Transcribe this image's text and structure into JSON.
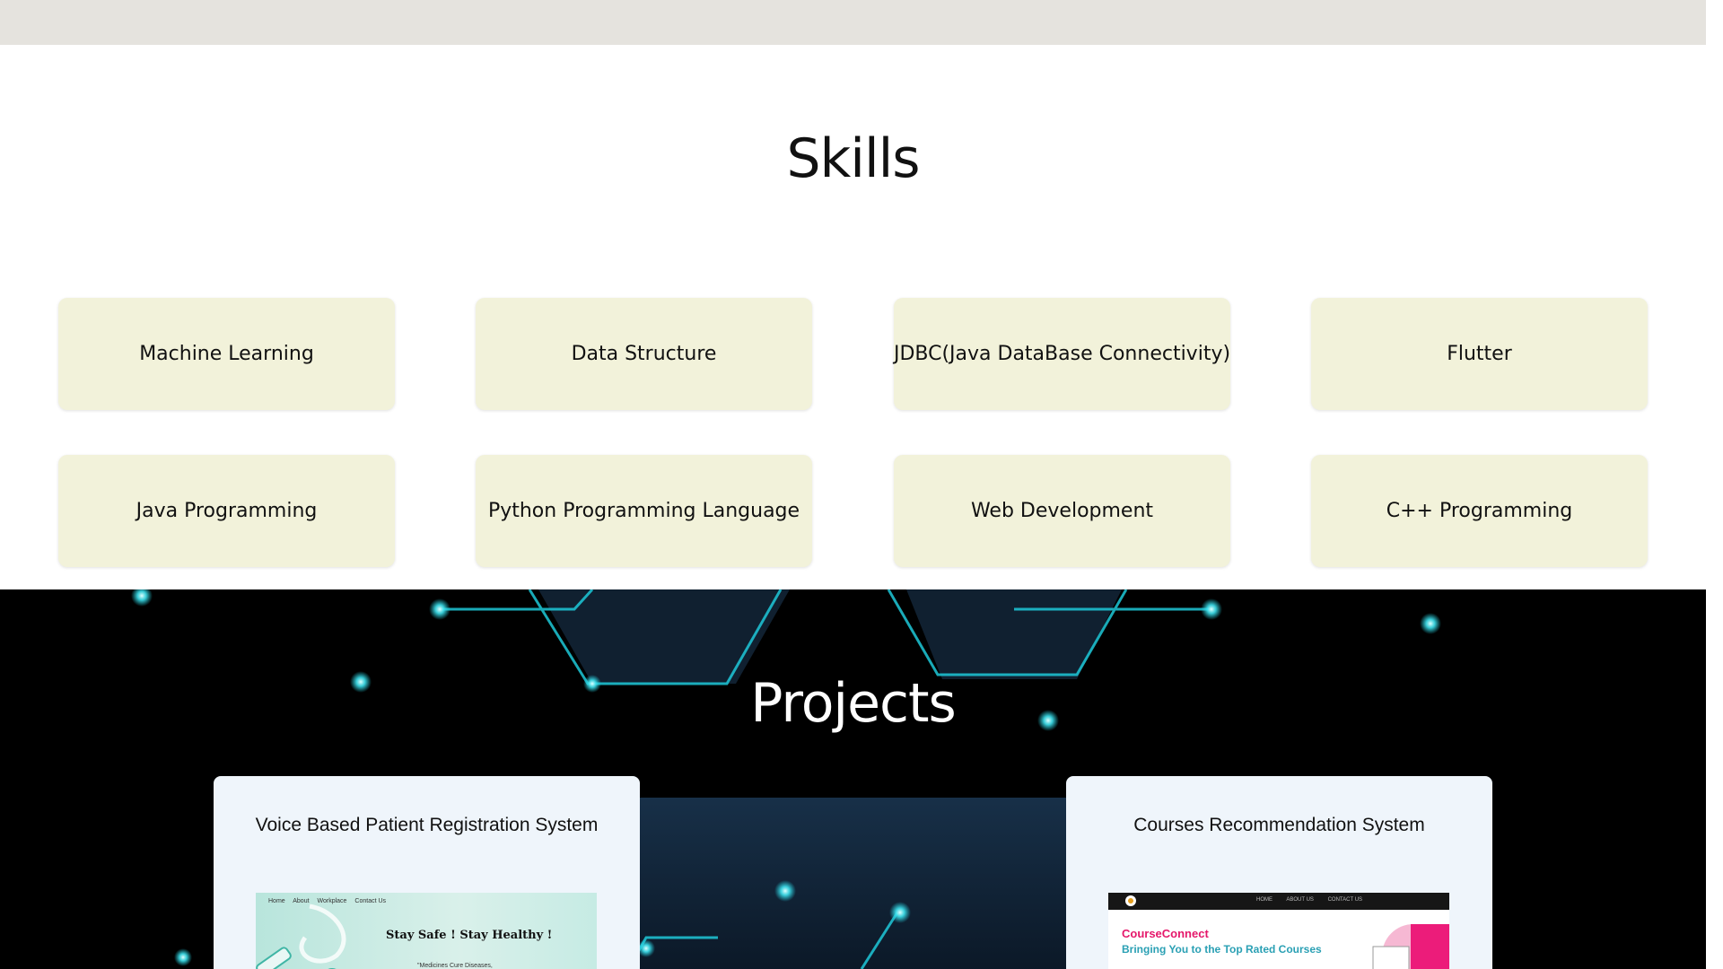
{
  "skills": {
    "title": "Skills",
    "items": [
      {
        "label": "Machine Learning"
      },
      {
        "label": "Data Structure"
      },
      {
        "label": "JDBC(Java DataBase Connectivity)"
      },
      {
        "label": "Flutter"
      },
      {
        "label": "Java Programming"
      },
      {
        "label": "Python Programming Language"
      },
      {
        "label": "Web Development"
      },
      {
        "label": "C++ Programming"
      }
    ]
  },
  "projects": {
    "title": "Projects",
    "items": [
      {
        "title": "Voice Based Patient Registration System",
        "thumbnail": {
          "nav": [
            "Home",
            "About",
            "Workplace",
            "Contact Us"
          ],
          "headline": "Stay Safe ! Stay Healthy !",
          "subtext": "\"Medicines Cure Diseases,"
        }
      },
      {
        "title": "Courses Recommendation System",
        "thumbnail": {
          "nav": [
            "HOME",
            "ABOUT US",
            "CONTACT US"
          ],
          "brand": "CourseConnect",
          "tagline": "Bringing You to the Top Rated Courses"
        }
      }
    ]
  },
  "scrollbar": {
    "up_icon": "▲",
    "down_icon": "▼"
  },
  "colors": {
    "topbar": "#e5e3de",
    "skill_card": "#f2f2da",
    "projects_bg": "#000000",
    "project_card": "#eff5fb",
    "accent_cyan": "#1ec8d8",
    "brand_pink": "#e5186b"
  }
}
